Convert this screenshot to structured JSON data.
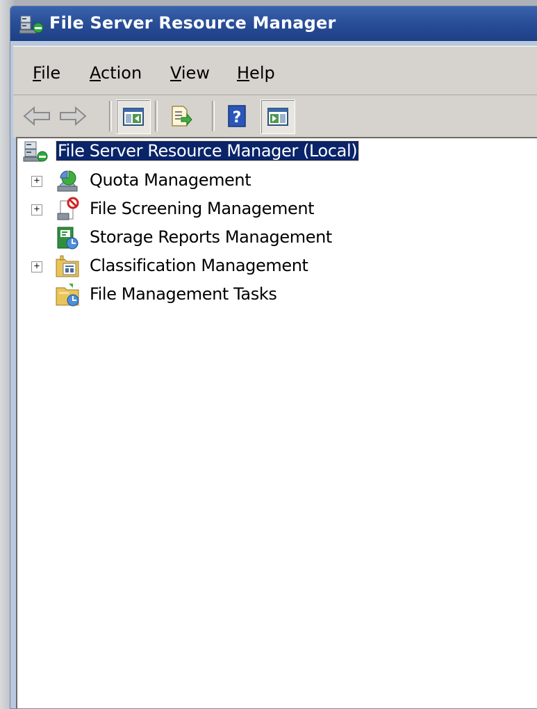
{
  "window": {
    "title": "File Server Resource Manager",
    "title_color": "#2a4f99"
  },
  "menu": {
    "items": [
      {
        "accel": "F",
        "rest": "ile"
      },
      {
        "accel": "A",
        "rest": "ction"
      },
      {
        "accel": "V",
        "rest": "iew"
      },
      {
        "accel": "H",
        "rest": "elp"
      }
    ]
  },
  "toolbar": {
    "buttons": [
      "back-arrow-icon",
      "forward-arrow-icon",
      "show-hide-console-tree-icon",
      "export-list-icon",
      "help-icon",
      "show-hide-action-pane-icon"
    ]
  },
  "tree": {
    "root": {
      "label": "File Server Resource Manager (Local)",
      "selected": true,
      "selection_color": "#0a246a"
    },
    "children": [
      {
        "label": "Quota Management",
        "expandable": true,
        "icon": "quota-management-icon"
      },
      {
        "label": "File Screening Management",
        "expandable": true,
        "icon": "file-screening-icon"
      },
      {
        "label": "Storage Reports Management",
        "expandable": false,
        "icon": "storage-reports-icon"
      },
      {
        "label": "Classification Management",
        "expandable": true,
        "icon": "classification-icon"
      },
      {
        "label": "File Management Tasks",
        "expandable": false,
        "icon": "file-management-tasks-icon"
      }
    ]
  }
}
